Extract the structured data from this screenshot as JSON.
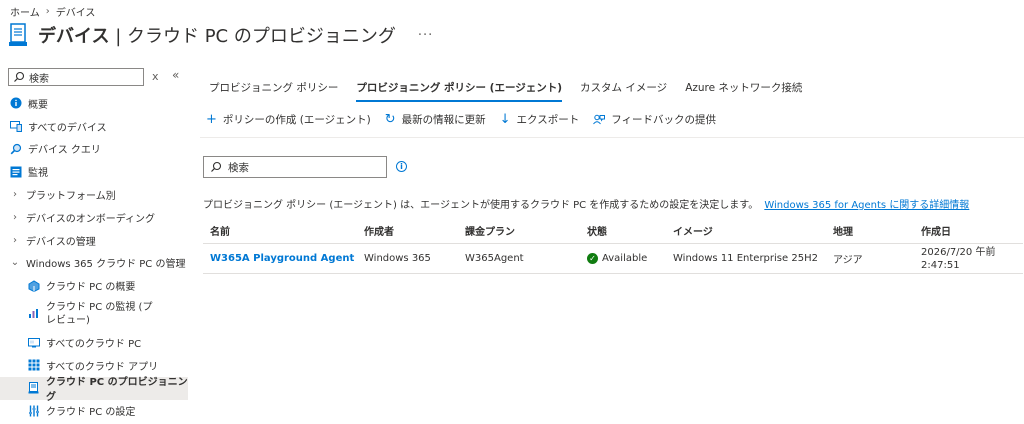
{
  "breadcrumb": {
    "home": "ホーム",
    "current": "デバイス"
  },
  "header": {
    "title_main": "デバイス",
    "title_sep": " | ",
    "title_sub": "クラウド PC のプロビジョニング",
    "more": "···"
  },
  "sidebar": {
    "search_placeholder": "検索",
    "close": "x",
    "collapse": "«",
    "items": [
      {
        "label": "概要",
        "icon": "info-icon"
      },
      {
        "label": "すべてのデバイス",
        "icon": "devices-icon"
      },
      {
        "label": "デバイス クエリ",
        "icon": "query-icon"
      },
      {
        "label": "監視",
        "icon": "monitor-icon"
      },
      {
        "label": "プラットフォーム別",
        "icon": "chevron-right-icon"
      },
      {
        "label": "デバイスのオンボーディング",
        "icon": "chevron-right-icon"
      },
      {
        "label": "デバイスの管理",
        "icon": "chevron-right-icon"
      },
      {
        "label": "Windows 365 クラウド PC の管理",
        "icon": "chevron-down-icon"
      },
      {
        "label": "クラウド PC の概要",
        "icon": "cloud-pc-icon"
      },
      {
        "label": "クラウド PC の監視 (プレビュー)",
        "icon": "chart-icon"
      },
      {
        "label": "すべてのクラウド PC",
        "icon": "pc-list-icon"
      },
      {
        "label": "すべてのクラウド アプリ",
        "icon": "apps-icon"
      },
      {
        "label": "クラウド PC のプロビジョニング",
        "icon": "provisioning-icon"
      },
      {
        "label": "クラウド PC の設定",
        "icon": "settings-icon"
      }
    ]
  },
  "tabs": [
    {
      "label": "プロビジョニング ポリシー"
    },
    {
      "label": "プロビジョニング ポリシー (エージェント)"
    },
    {
      "label": "カスタム イメージ"
    },
    {
      "label": "Azure ネットワーク接続"
    }
  ],
  "toolbar": {
    "create": "ポリシーの作成 (エージェント)",
    "refresh": "最新の情報に更新",
    "export": "エクスポート",
    "feedback": "フィードバックの提供"
  },
  "search": {
    "placeholder": "検索"
  },
  "description": {
    "text": "プロビジョニング ポリシー (エージェント) は、エージェントが使用するクラウド PC を作成するための設定を決定します。",
    "link": "Windows 365 for Agents に関する詳細情報"
  },
  "table": {
    "columns": [
      "名前",
      "作成者",
      "課金プラン",
      "状態",
      "イメージ",
      "地理",
      "作成日"
    ],
    "rows": [
      {
        "name": "W365A Playground Agent",
        "creator": "Windows 365",
        "plan": "W365Agent",
        "status": "Available",
        "image": "Windows 11 Enterprise 25H2",
        "geo": "アジア",
        "created_line1": "2026/7/20 午前",
        "created_line2": "2:47:51"
      }
    ]
  },
  "colors": {
    "accent": "#0078d4",
    "success": "#107c10"
  }
}
